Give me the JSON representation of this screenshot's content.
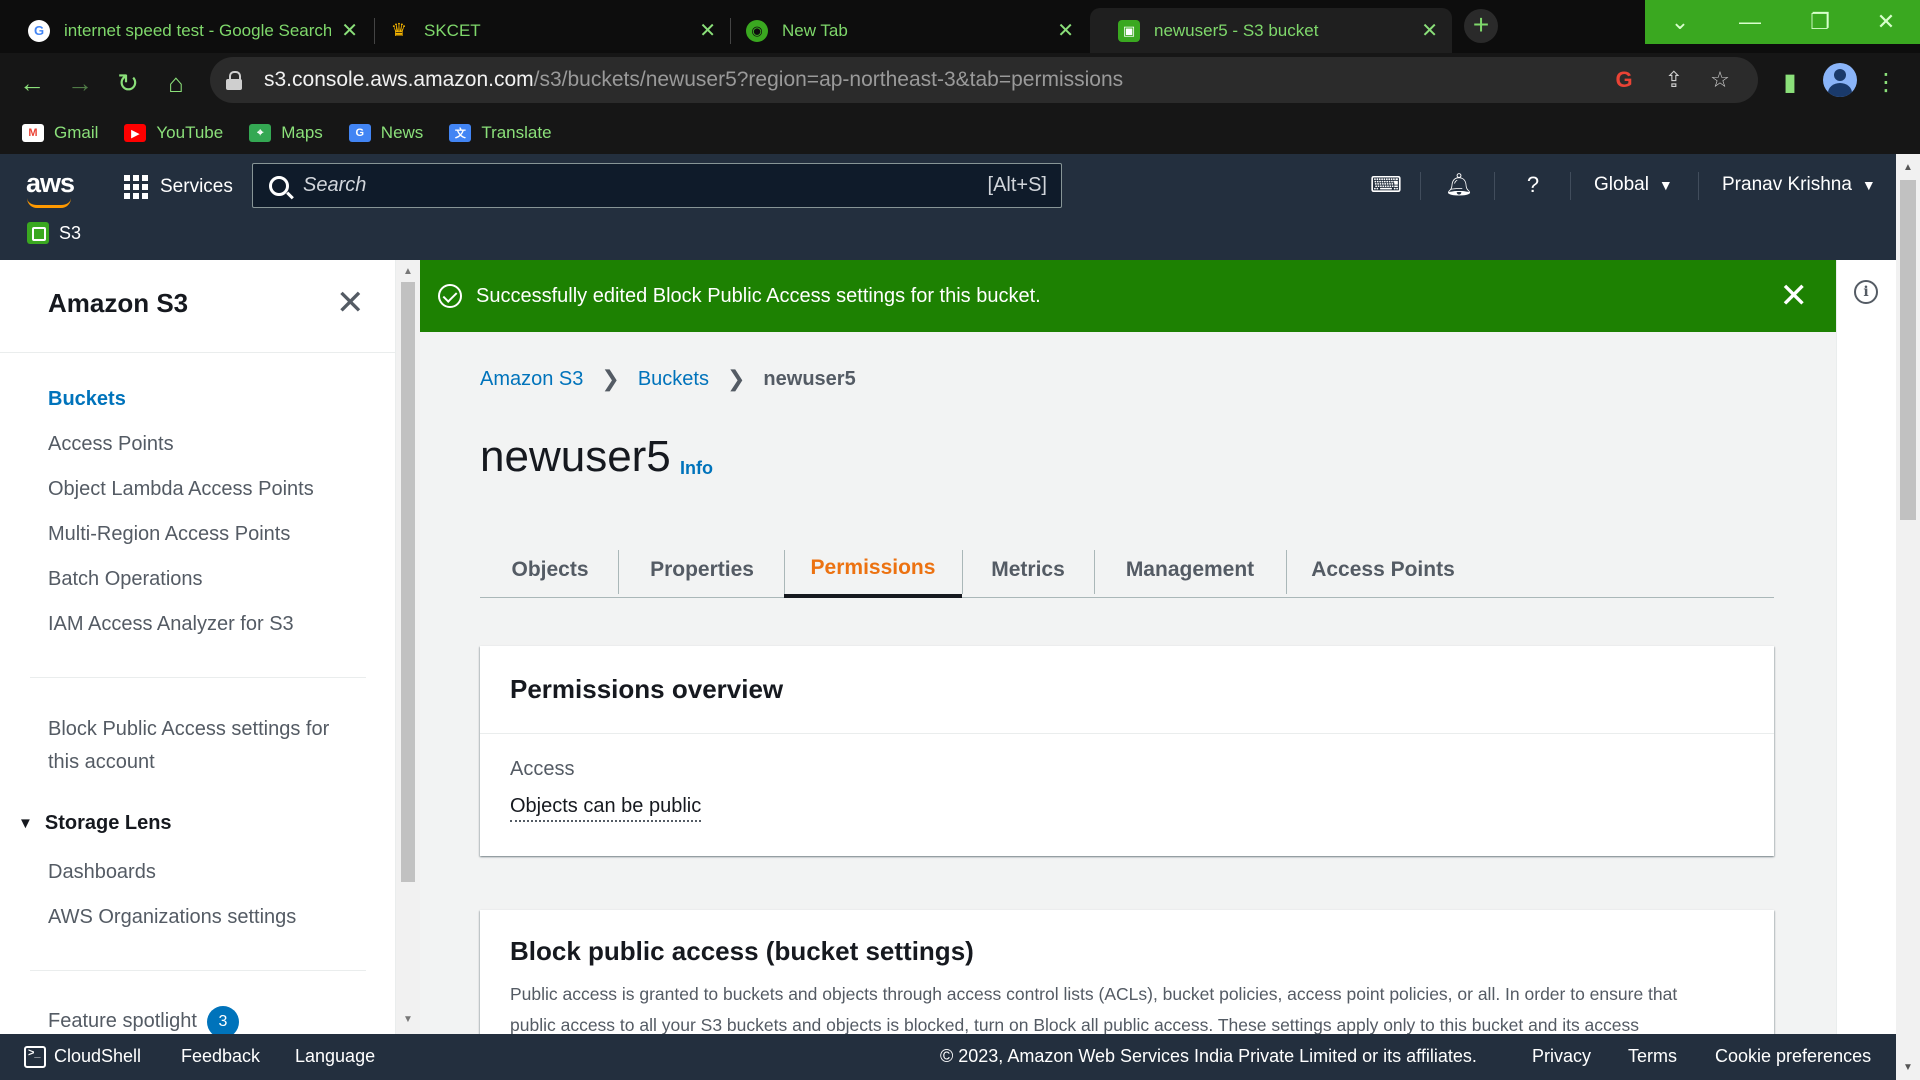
{
  "browser": {
    "tabs": [
      {
        "title": "internet speed test - Google Search",
        "icon": "google-icon"
      },
      {
        "title": "SKCET",
        "icon": "skcet-icon"
      },
      {
        "title": "New Tab",
        "icon": "chrome-icon"
      },
      {
        "title": "newuser5 - S3 bucket",
        "icon": "s3-icon"
      }
    ],
    "url_host": "s3.console.aws.amazon.com",
    "url_path": "/s3/buckets/newuser5?region=ap-northeast-3&tab=permissions",
    "bookmarks": [
      {
        "label": "Gmail",
        "icon": "gmail-icon"
      },
      {
        "label": "YouTube",
        "icon": "youtube-icon"
      },
      {
        "label": "Maps",
        "icon": "maps-icon"
      },
      {
        "label": "News",
        "icon": "news-icon"
      },
      {
        "label": "Translate",
        "icon": "translate-icon"
      }
    ]
  },
  "console": {
    "logo": "aws",
    "services_label": "Services",
    "search_placeholder": "Search",
    "search_shortcut": "[Alt+S]",
    "region": "Global",
    "user": "Pranav Krishna",
    "service_crumb": "S3"
  },
  "sidebar": {
    "title": "Amazon S3",
    "items": [
      {
        "label": "Buckets",
        "active": true
      },
      {
        "label": "Access Points"
      },
      {
        "label": "Object Lambda Access Points"
      },
      {
        "label": "Multi-Region Access Points"
      },
      {
        "label": "Batch Operations"
      },
      {
        "label": "IAM Access Analyzer for S3"
      }
    ],
    "block_public_line1": "Block Public Access settings for",
    "block_public_line2": "this account",
    "storage_lens": {
      "title": "Storage Lens",
      "items": [
        {
          "label": "Dashboards"
        },
        {
          "label": "AWS Organizations settings"
        }
      ]
    },
    "feature_spotlight": {
      "label": "Feature spotlight",
      "count": "3"
    }
  },
  "flash": {
    "message": "Successfully edited Block Public Access settings for this bucket.",
    "color": "#1d8102"
  },
  "breadcrumb": {
    "items": [
      "Amazon S3",
      "Buckets"
    ],
    "current": "newuser5"
  },
  "bucket": {
    "name": "newuser5",
    "info_label": "Info"
  },
  "tabs": {
    "items": [
      "Objects",
      "Properties",
      "Permissions",
      "Metrics",
      "Management",
      "Access Points"
    ],
    "active": "Permissions"
  },
  "permissions_overview": {
    "title": "Permissions overview",
    "access_label": "Access",
    "access_value": "Objects can be public"
  },
  "block_public_access": {
    "title": "Block public access (bucket settings)",
    "description_line1": "Public access is granted to buckets and objects through access control lists (ACLs), bucket policies, access point policies, or all. In order to ensure that",
    "description_line2": "public access to all your S3 buckets and objects is blocked, turn on Block all public access. These settings apply only to this bucket and its access"
  },
  "footer": {
    "cloudshell": "CloudShell",
    "feedback": "Feedback",
    "language": "Language",
    "copyright": "© 2023, Amazon Web Services India Private Limited or its affiliates.",
    "privacy": "Privacy",
    "terms": "Terms",
    "cookie": "Cookie preferences"
  },
  "colors": {
    "aws_header": "#232f3e",
    "link": "#0073bb",
    "active_tab": "#ec7211",
    "browser_accent": "#7fd86b"
  }
}
